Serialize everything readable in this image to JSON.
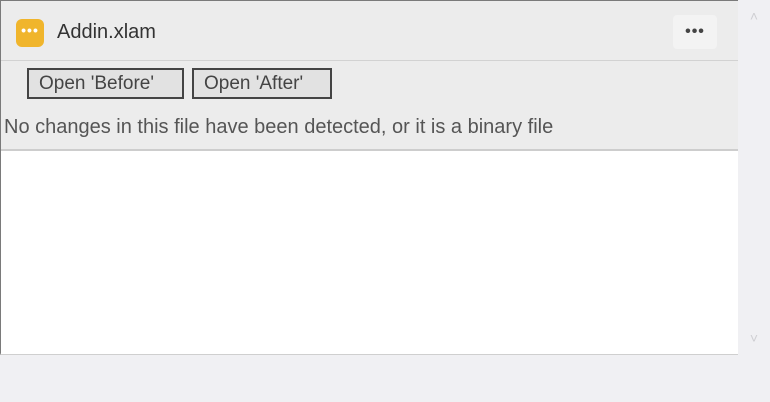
{
  "file": {
    "name": "Addin.xlam",
    "icon": "ellipsis-file-icon",
    "icon_color": "#f0b52c",
    "icon_glyph": "•••"
  },
  "header": {
    "more_label": "•••"
  },
  "toolbar": {
    "open_before_label": "Open 'Before'",
    "open_after_label": "Open 'After'"
  },
  "message": {
    "text": "No changes in this file have been detected, or it is a binary file"
  },
  "scrollbar": {
    "up_glyph": "˄",
    "down_glyph": "˅"
  }
}
